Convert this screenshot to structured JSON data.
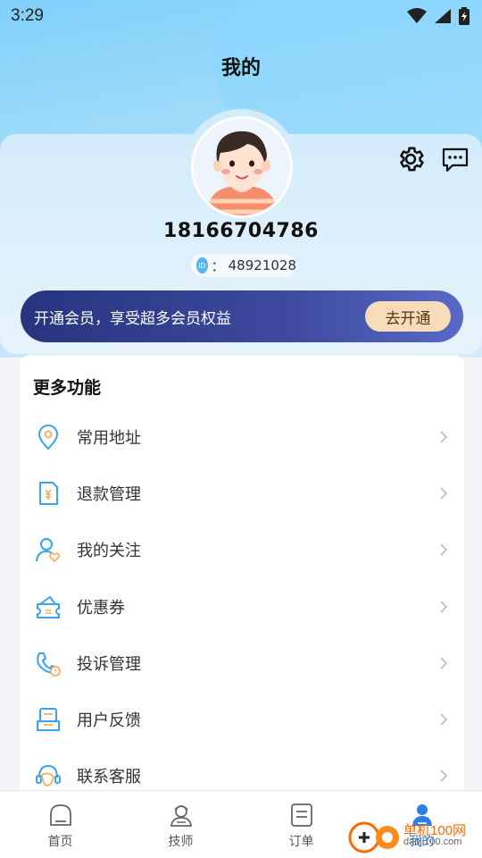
{
  "status": {
    "time": "3:29"
  },
  "header": {
    "title": "我的"
  },
  "profile": {
    "phone": "18166704786",
    "id_prefix": "：",
    "id_value": "48921028",
    "id_badge": "ID"
  },
  "vip": {
    "text": "开通会员，享受超多会员权益",
    "button": "去开通"
  },
  "menu": {
    "title": "更多功能",
    "items": [
      {
        "label": "常用地址",
        "icon": "location-pin-icon"
      },
      {
        "label": "退款管理",
        "icon": "refund-document-icon"
      },
      {
        "label": "我的关注",
        "icon": "follow-user-heart-icon"
      },
      {
        "label": "优惠券",
        "icon": "coupon-icon"
      },
      {
        "label": "投诉管理",
        "icon": "complaint-phone-icon"
      },
      {
        "label": "用户反馈",
        "icon": "feedback-icon"
      },
      {
        "label": "联系客服",
        "icon": "customer-service-headset-icon"
      }
    ]
  },
  "tabs": [
    {
      "label": "首页",
      "icon": "home-icon"
    },
    {
      "label": "技师",
      "icon": "technician-icon"
    },
    {
      "label": "订单",
      "icon": "order-list-icon"
    },
    {
      "label": "我的",
      "icon": "profile-icon",
      "active": true
    }
  ],
  "watermark": {
    "top": "单机100网",
    "bottom": "danji100.com"
  },
  "colors": {
    "accent": "#2d7fe6",
    "icon_blue": "#3aa3ee",
    "icon_orange": "#f5b061",
    "vip_bg": "#27347e",
    "vip_button": "#f6dcb9"
  }
}
